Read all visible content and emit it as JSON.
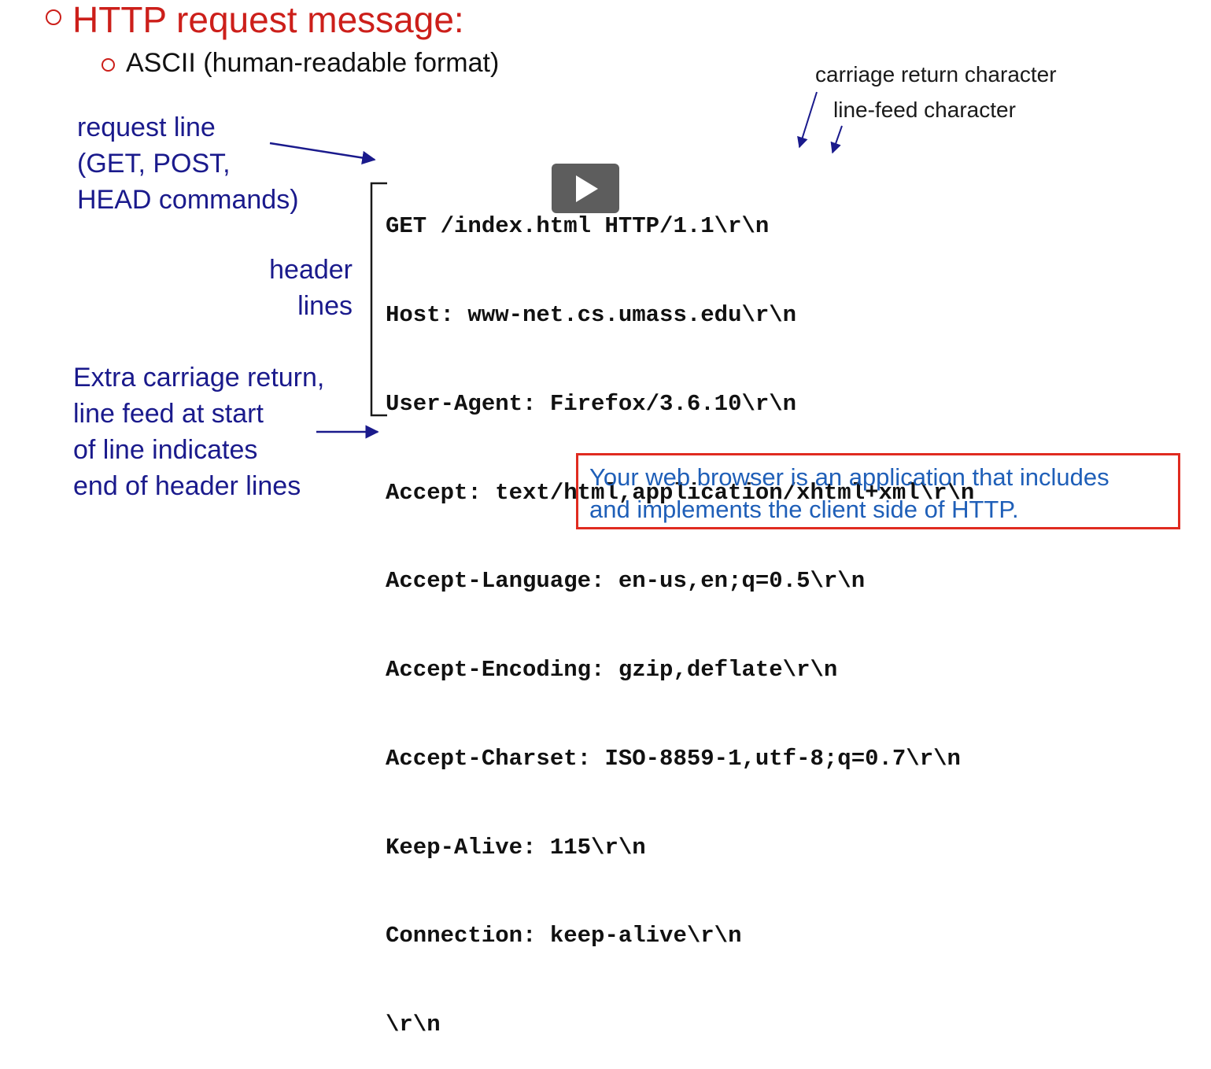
{
  "slide": {
    "title": "HTTP request message:",
    "subtitle": "ASCII (human-readable format)"
  },
  "annotations": {
    "request_line": [
      "request line",
      "(GET, POST,",
      "HEAD commands)"
    ],
    "header_lines": [
      "header",
      "lines"
    ],
    "extra_crlf": [
      "Extra carriage return,",
      "line feed at start",
      "of line indicates",
      "end of header lines"
    ],
    "carriage_return": "carriage return character",
    "line_feed": "line-feed character"
  },
  "request_message": [
    "GET /index.html HTTP/1.1\\r\\n",
    "Host: www-net.cs.umass.edu\\r\\n",
    "User-Agent: Firefox/3.6.10\\r\\n",
    "Accept: text/html,application/xhtml+xml\\r\\n",
    "Accept-Language: en-us,en;q=0.5\\r\\n",
    "Accept-Encoding: gzip,deflate\\r\\n",
    "Accept-Charset: ISO-8859-1,utf-8;q=0.7\\r\\n",
    "Keep-Alive: 115\\r\\n",
    "Connection: keep-alive\\r\\n",
    "\\r\\n"
  ],
  "note": [
    "Your web browser is an application that includes",
    "and implements the client side of HTTP."
  ],
  "video": {
    "play_icon": "play-icon"
  },
  "colors": {
    "title_red": "#cc1f1a",
    "annotation_blue": "#1a1a8c",
    "note_blue": "#1f5fb8",
    "note_border": "#e02b20",
    "text_black": "#111111"
  }
}
